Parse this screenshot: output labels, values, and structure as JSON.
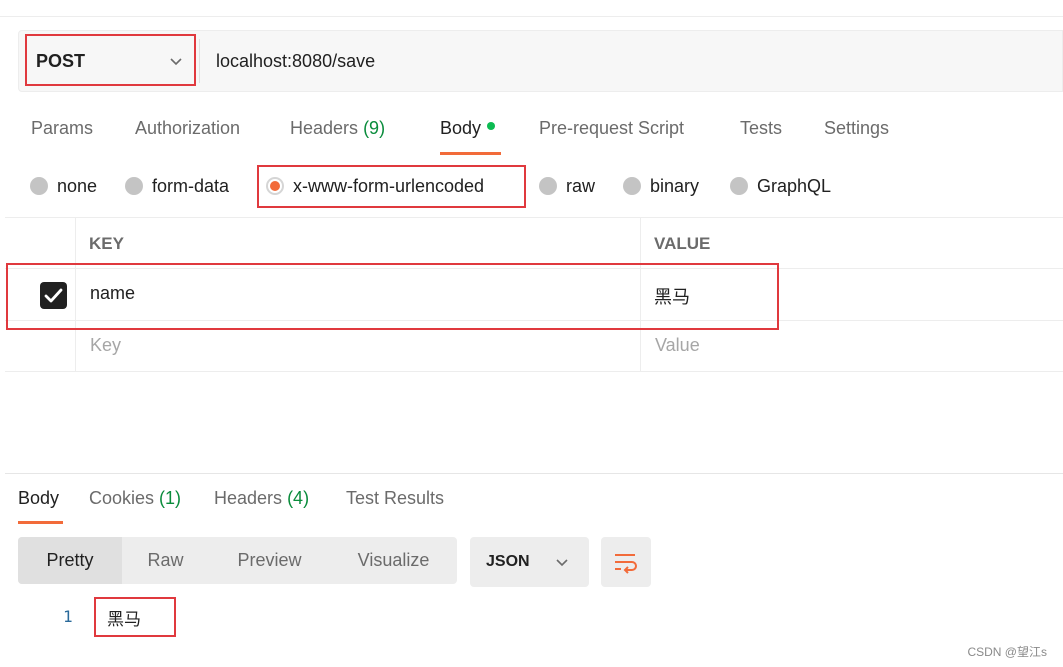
{
  "request": {
    "method": "POST",
    "url": "localhost:8080/save"
  },
  "request_tabs": [
    {
      "label": "Params"
    },
    {
      "label": "Authorization"
    },
    {
      "label": "Headers",
      "count": "(9)"
    },
    {
      "label": "Body"
    },
    {
      "label": "Pre-request Script"
    },
    {
      "label": "Tests"
    },
    {
      "label": "Settings"
    }
  ],
  "body_types": [
    "none",
    "form-data",
    "x-www-form-urlencoded",
    "raw",
    "binary",
    "GraphQL"
  ],
  "body_type_selected": "x-www-form-urlencoded",
  "table": {
    "headers": {
      "key": "KEY",
      "value": "VALUE"
    },
    "rows": [
      {
        "checked": true,
        "key": "name",
        "value": "黑马"
      }
    ],
    "placeholders": {
      "key": "Key",
      "value": "Value"
    }
  },
  "response_tabs": [
    {
      "label": "Body"
    },
    {
      "label": "Cookies",
      "count": "(1)"
    },
    {
      "label": "Headers",
      "count": "(4)"
    },
    {
      "label": "Test Results"
    }
  ],
  "format_buttons": [
    "Pretty",
    "Raw",
    "Preview",
    "Visualize"
  ],
  "format_selected": "Pretty",
  "language": "JSON",
  "response_body": {
    "line_number": "1",
    "content": "黑马"
  },
  "watermark": "CSDN @望江s",
  "colors": {
    "accent": "#f26b3a",
    "count_green": "#0a8c3c",
    "highlight_red": "#e0393e"
  }
}
